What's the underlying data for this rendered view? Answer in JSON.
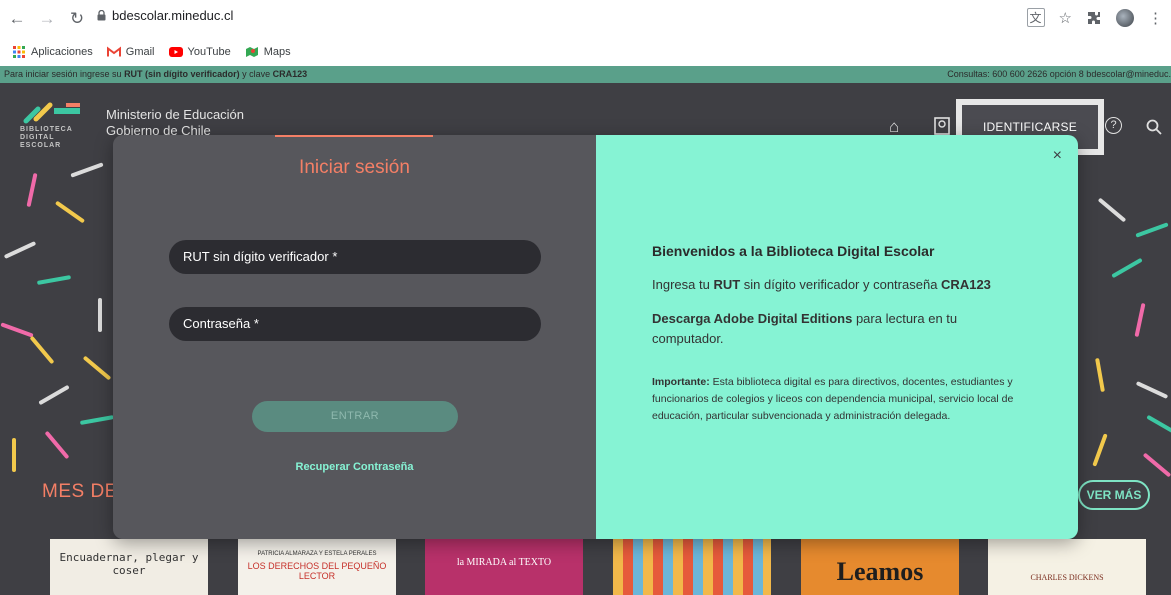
{
  "browser": {
    "url": "bdescolar.mineduc.cl",
    "bookmarks": [
      "Aplicaciones",
      "Gmail",
      "YouTube",
      "Maps"
    ]
  },
  "infobar": {
    "left_prefix": "Para iniciar sesión ingrese su ",
    "left_rut": "RUT (sin dígito verificador)",
    "left_mid": " y clave ",
    "left_code": "CRA123",
    "right": "Consultas: 600 600 2626 opción 8   bdescolar@mineduc."
  },
  "site": {
    "logo_text_1": "BIBLIOTECA",
    "logo_text_2": "DIGITAL",
    "logo_text_3": "ESCOLAR",
    "ministry_line1": "Ministerio de Educación",
    "ministry_line2": "Gobierno de Chile",
    "identificarse_label": "IDENTIFICARSE",
    "section_title": "MES DE",
    "ver_mas_label": "VER MÁS"
  },
  "modal": {
    "title": "Iniciar sesión",
    "rut_placeholder": "RUT sin dígito verificador *",
    "password_placeholder": "Contraseña *",
    "submit_label": "ENTRAR",
    "recover_label": "Recuperar Contraseña",
    "close_label": "×",
    "welcome_title": "Bienvenidos a la Biblioteca Digital Escolar",
    "p1_a": "Ingresa tu ",
    "p1_rut": "RUT",
    "p1_b": " sin dígito verificador y contraseña ",
    "p1_code": "CRA123",
    "p2_bold": "Descarga Adobe Digital Editions",
    "p2_rest": " para lectura en tu computador.",
    "p3_bold": "Importante:",
    "p3_rest": " Esta biblioteca digital es para directivos, docentes, estudiantes y funcionarios de colegios y liceos con dependencia municipal, servicio local de educación, particular subvencionada y administración delegada."
  },
  "books": [
    {
      "title": "Encuadernar, plegar y coser"
    },
    {
      "title": "LOS DERECHOS DEL PEQUEÑO LECTOR",
      "authors": "PATRICIA ALMARAZA  Y  ESTELA PERALES"
    },
    {
      "title": "la MIRADA al TEXTO"
    },
    {
      "title": ""
    },
    {
      "title": "Leamos"
    },
    {
      "title": "CHARLES DICKENS"
    }
  ],
  "colors": {
    "accent_salmon": "#f47f66",
    "accent_mint": "#86f3d4",
    "infobar_green": "#5aa08a",
    "page_bg": "#3f3f44"
  }
}
